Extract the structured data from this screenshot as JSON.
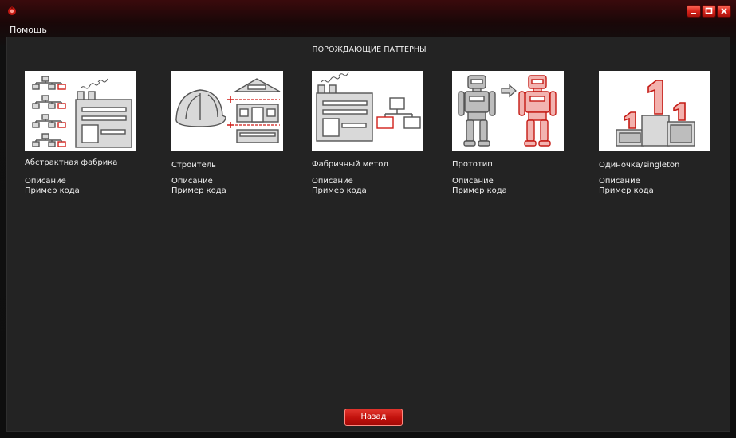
{
  "window": {
    "controls": {
      "minimize_icon": "minimize-icon",
      "maximize_icon": "maximize-icon",
      "close_icon": "close-icon"
    }
  },
  "menu": {
    "items": [
      {
        "label": "Помощь"
      }
    ]
  },
  "page": {
    "title": "ПОРОЖДАЮЩИЕ ПАТТЕРНЫ"
  },
  "patterns": [
    {
      "title": "Абстрактная фабрика",
      "description": "Описание",
      "code": "Пример кода",
      "icon": "abstract-factory-icon"
    },
    {
      "title": "Строитель",
      "description": "Описание",
      "code": "Пример кода",
      "icon": "builder-icon"
    },
    {
      "title": "Фабричный метод",
      "description": "Описание",
      "code": "Пример кода",
      "icon": "factory-method-icon"
    },
    {
      "title": "Прототип",
      "description": "Описание",
      "code": "Пример кода",
      "icon": "prototype-icon"
    },
    {
      "title": "Одиночка/singleton",
      "description": "Описание",
      "code": "Пример кода",
      "icon": "singleton-icon"
    }
  ],
  "footer": {
    "back_label": "Назад"
  },
  "colors": {
    "accent": "#d11f19",
    "content_bg": "#232323",
    "text": "#f0f0f0"
  }
}
